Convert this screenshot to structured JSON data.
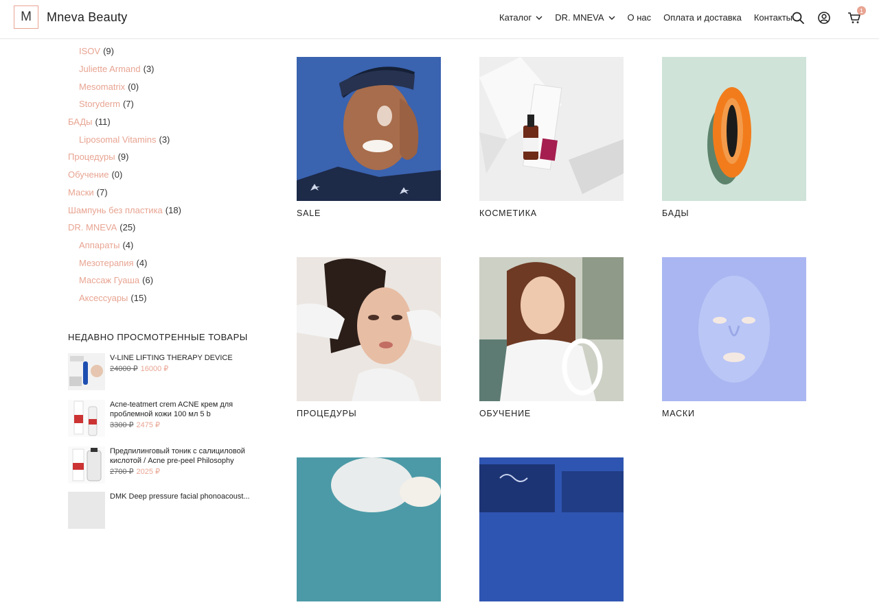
{
  "header": {
    "logo_letter": "M",
    "brand": "Mneva Beauty",
    "nav": [
      {
        "label": "Каталог",
        "has_dropdown": true
      },
      {
        "label": "DR. MNEVA",
        "has_dropdown": true
      },
      {
        "label": "О нас",
        "has_dropdown": false
      },
      {
        "label": "Оплата и доставка",
        "has_dropdown": false
      },
      {
        "label": "Контакты",
        "has_dropdown": false
      }
    ],
    "icons": [
      "search-icon",
      "account-icon",
      "cart-icon"
    ],
    "cart_count": "1"
  },
  "sidebar": {
    "categories": [
      {
        "label": "ISOV",
        "count": "(9)",
        "sub": true
      },
      {
        "label": "Juliette Armand",
        "count": "(3)",
        "sub": true
      },
      {
        "label": "Mesomatrix",
        "count": "(0)",
        "sub": true
      },
      {
        "label": "Storyderm",
        "count": "(7)",
        "sub": true
      },
      {
        "label": "БАДы",
        "count": "(11)",
        "sub": false
      },
      {
        "label": "Liposomal Vitamins",
        "count": "(3)",
        "sub": true
      },
      {
        "label": "Процедуры",
        "count": "(9)",
        "sub": false
      },
      {
        "label": "Обучение",
        "count": "(0)",
        "sub": false
      },
      {
        "label": "Маски",
        "count": "(7)",
        "sub": false
      },
      {
        "label": "Шампунь без пластика",
        "count": "(18)",
        "sub": false
      },
      {
        "label": "DR. MNEVA",
        "count": "(25)",
        "sub": false
      },
      {
        "label": "Аппараты",
        "count": "(4)",
        "sub": true
      },
      {
        "label": "Мезотерапия",
        "count": "(4)",
        "sub": true
      },
      {
        "label": "Массаж Гуаша",
        "count": "(6)",
        "sub": true
      },
      {
        "label": "Аксессуары",
        "count": "(15)",
        "sub": true
      }
    ],
    "recent_title": "НЕДАВНО ПРОСМОТРЕННЫЕ ТОВАРЫ",
    "recent": [
      {
        "name": "V-LINE LIFTING THERAPY DEVICE",
        "old_price": "24000 ₽",
        "new_price": "16000 ₽"
      },
      {
        "name": "Acne-teatmert crem ACNE крем для проблемной кожи 100 мл 5 b",
        "old_price": "3300 ₽",
        "new_price": "2475 ₽"
      },
      {
        "name": "Предпилинговый тоник с салициловой кислотой / Acne pre-peel Philosophy",
        "old_price": "2700 ₽",
        "new_price": "2025 ₽"
      },
      {
        "name": "DMK Deep pressure facial phonoacoust...",
        "old_price": "",
        "new_price": ""
      }
    ]
  },
  "grid": {
    "cards": [
      {
        "title": "SALE"
      },
      {
        "title": "КОСМЕТИКА"
      },
      {
        "title": "БАДЫ"
      },
      {
        "title": "ПРОЦЕДУРЫ"
      },
      {
        "title": "ОБУЧЕНИЕ"
      },
      {
        "title": "МАСКИ"
      },
      {
        "title": ""
      },
      {
        "title": ""
      }
    ]
  },
  "colors": {
    "accent": "#e8a492",
    "text": "#222222",
    "border": "#e6e6e6"
  }
}
